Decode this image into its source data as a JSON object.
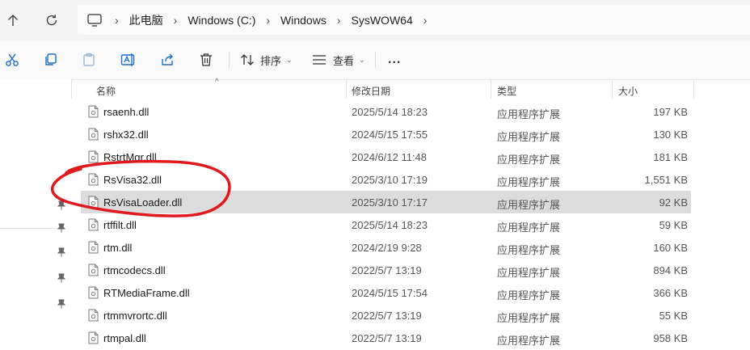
{
  "address": {
    "crumbs": [
      "此电脑",
      "Windows (C:)",
      "Windows",
      "SysWOW64"
    ]
  },
  "toolbar": {
    "sort_label": "排序",
    "view_label": "查看",
    "more_label": "..."
  },
  "columns": {
    "name": "名称",
    "date": "修改日期",
    "type": "类型",
    "size": "大小"
  },
  "files": [
    {
      "name": "rsaenh.dll",
      "date": "2025/5/14 18:23",
      "type": "应用程序扩展",
      "size": "197 KB"
    },
    {
      "name": "rshx32.dll",
      "date": "2024/5/15 17:55",
      "type": "应用程序扩展",
      "size": "130 KB"
    },
    {
      "name": "RstrtMgr.dll",
      "date": "2024/6/12 11:48",
      "type": "应用程序扩展",
      "size": "181 KB"
    },
    {
      "name": "RsVisa32.dll",
      "date": "2025/3/10 17:19",
      "type": "应用程序扩展",
      "size": "1,551 KB"
    },
    {
      "name": "RsVisaLoader.dll",
      "date": "2025/3/10 17:17",
      "type": "应用程序扩展",
      "size": "92 KB"
    },
    {
      "name": "rtffilt.dll",
      "date": "2025/5/14 18:23",
      "type": "应用程序扩展",
      "size": "59 KB"
    },
    {
      "name": "rtm.dll",
      "date": "2024/2/19 9:28",
      "type": "应用程序扩展",
      "size": "160 KB"
    },
    {
      "name": "rtmcodecs.dll",
      "date": "2022/5/7 13:19",
      "type": "应用程序扩展",
      "size": "894 KB"
    },
    {
      "name": "RTMediaFrame.dll",
      "date": "2024/5/15 17:54",
      "type": "应用程序扩展",
      "size": "366 KB"
    },
    {
      "name": "rtmmvrortc.dll",
      "date": "2022/5/7 13:19",
      "type": "应用程序扩展",
      "size": "55 KB"
    },
    {
      "name": "rtmpal.dll",
      "date": "2022/5/7 13:19",
      "type": "应用程序扩展",
      "size": "958 KB"
    }
  ],
  "selected_file": "RsVisaLoader.dll",
  "colors": {
    "selection": "#dcdcdc",
    "annotation": "#e0191e"
  }
}
